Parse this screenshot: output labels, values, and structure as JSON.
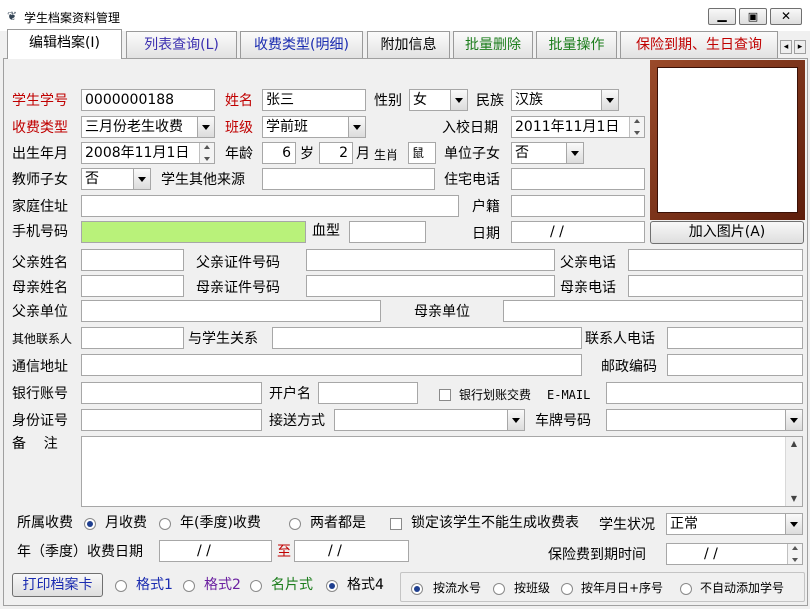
{
  "window": {
    "title": "学生档案资料管理"
  },
  "tabs": [
    {
      "label": "编辑档案(I)",
      "color": "#000000"
    },
    {
      "label": "列表查询(L)",
      "color": "#3b2fb0"
    },
    {
      "label": "收费类型(明细)",
      "color": "#1a2bb0"
    },
    {
      "label": "附加信息",
      "color": "#000000"
    },
    {
      "label": "批量删除",
      "color": "#1c7d1c"
    },
    {
      "label": "批量操作",
      "color": "#1c7d1c"
    },
    {
      "label": "保险到期、生日查询",
      "color": "#c00000"
    }
  ],
  "form": {
    "student_no_label": "学生学号",
    "student_no": "0000000188",
    "name_label": "姓名",
    "name": "张三",
    "gender_label": "性别",
    "gender": "女",
    "ethnicity_label": "民族",
    "ethnicity": "汉族",
    "fee_type_label": "收费类型",
    "fee_type": "三月份老生收费",
    "class_label": "班级",
    "class": "学前班",
    "enroll_date_label": "入校日期",
    "enroll_date": "2011年11月1日",
    "birth_label": "出生年月",
    "birth": "2008年11月1日",
    "age_label": "年龄",
    "age_years": "6",
    "age_years_unit": "岁",
    "age_months": "2",
    "age_months_unit": "月",
    "zodiac_label": "生肖",
    "zodiac": "鼠",
    "unit_child_label": "单位子女",
    "unit_child": "否",
    "teacher_child_label": "教师子女",
    "teacher_child": "否",
    "other_source_label": "学生其他来源",
    "home_phone_label": "住宅电话",
    "address_label": "家庭住址",
    "hukou_label": "户籍",
    "mobile_label": "手机号码",
    "blood_label": "血型",
    "date_label": "日期",
    "date_value": "/    /",
    "photo_button": "加入图片(A)",
    "father_name_label": "父亲姓名",
    "father_id_label": "父亲证件号码",
    "father_phone_label": "父亲电话",
    "mother_name_label": "母亲姓名",
    "mother_id_label": "母亲证件号码",
    "mother_phone_label": "母亲电话",
    "father_work_label": "父亲单位",
    "mother_work_label": "母亲单位",
    "other_contact_label": "其他联系人",
    "relation_label": "与学生关系",
    "contact_phone_label": "联系人电话",
    "mail_address_label": "通信地址",
    "postcode_label": "邮政编码",
    "bank_label": "银行账号",
    "account_name_label": "开户名",
    "bank_deduct_label": "银行划账交费",
    "email_label": "E-MAIL",
    "id_card_label": "身份证号",
    "transport_label": "接送方式",
    "plate_label": "车牌号码",
    "remark_label": "备    注"
  },
  "fee": {
    "belong_label": "所属收费",
    "opt_monthly": "月收费",
    "opt_yearly": "年(季度)收费",
    "opt_both": "两者都是",
    "lock_label": "锁定该学生不能生成收费表",
    "status_label": "学生状况",
    "status": "正常",
    "period_label": "年（季度）收费日期",
    "period_from": "/    /",
    "to_label": "至",
    "period_to": "/    /",
    "insurance_label": "保险费到期时间",
    "insurance": "/    /"
  },
  "bottom": {
    "print_button": "打印档案卡",
    "fmt1": "格式1",
    "fmt2": "格式2",
    "card": "名片式",
    "fmt4": "格式4",
    "sort_serial": "按流水号",
    "sort_class": "按班级",
    "sort_date": "按年月日+序号",
    "sort_none": "不自动添加学号"
  },
  "colors": {
    "label_red": "#c00000",
    "mobile_fill": "#b9f27a",
    "photo_frame": "#7a2d16"
  }
}
